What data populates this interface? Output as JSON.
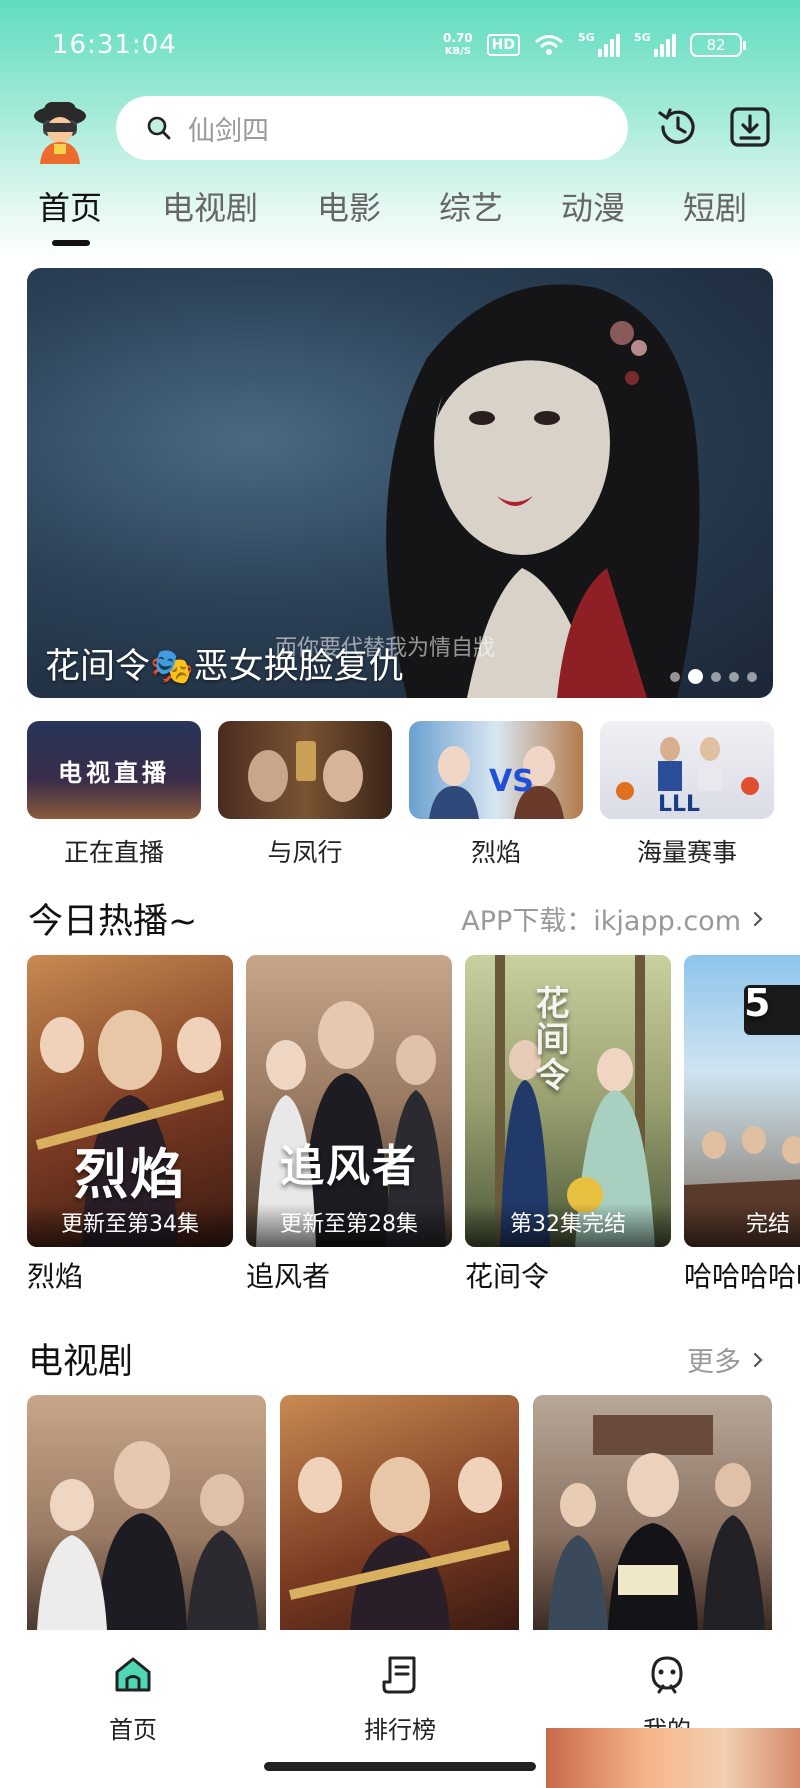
{
  "status_bar": {
    "time": "16:31:04",
    "net_speed_value": "0.70",
    "net_speed_unit": "KB/S",
    "hd_badge": "HD",
    "signal_1_label": "5G",
    "signal_2_label": "5G",
    "battery": "82"
  },
  "header": {
    "search_placeholder": "仙剑四"
  },
  "tabs": [
    {
      "label": "首页",
      "active": true
    },
    {
      "label": "电视剧",
      "active": false
    },
    {
      "label": "电影",
      "active": false
    },
    {
      "label": "综艺",
      "active": false
    },
    {
      "label": "动漫",
      "active": false
    },
    {
      "label": "短剧",
      "active": false
    }
  ],
  "banner": {
    "title": "花间令🎭恶女换脸复仇",
    "subtitle": "而你要代替我为情自戕",
    "dot_count": 5,
    "active_dot": 1
  },
  "quick_links": [
    {
      "label": "正在直播",
      "thumb_text": "电视直播"
    },
    {
      "label": "与凤行"
    },
    {
      "label": "烈焰"
    },
    {
      "label": "海量赛事"
    }
  ],
  "hot_section": {
    "title": "今日热播~",
    "more": "APP下载：ikjapp.com",
    "items": [
      {
        "title": "烈焰",
        "badge": "更新至第34集",
        "poster_text": "烈焰"
      },
      {
        "title": "追风者",
        "badge": "更新至第28集",
        "poster_text": "追风者"
      },
      {
        "title": "花间令",
        "badge": "第32集完结",
        "poster_text": "花间令"
      },
      {
        "title": "哈哈哈哈哈",
        "badge": "完结",
        "poster_text": "5"
      }
    ]
  },
  "tv_section": {
    "title": "电视剧",
    "more": "更多"
  },
  "bottom_nav": [
    {
      "label": "首页",
      "active": true
    },
    {
      "label": "排行榜",
      "active": false
    },
    {
      "label": "我的",
      "active": false
    }
  ],
  "colors": {
    "accent": "#3dc9a4",
    "header_gradient_top": "#5fdcc0"
  }
}
